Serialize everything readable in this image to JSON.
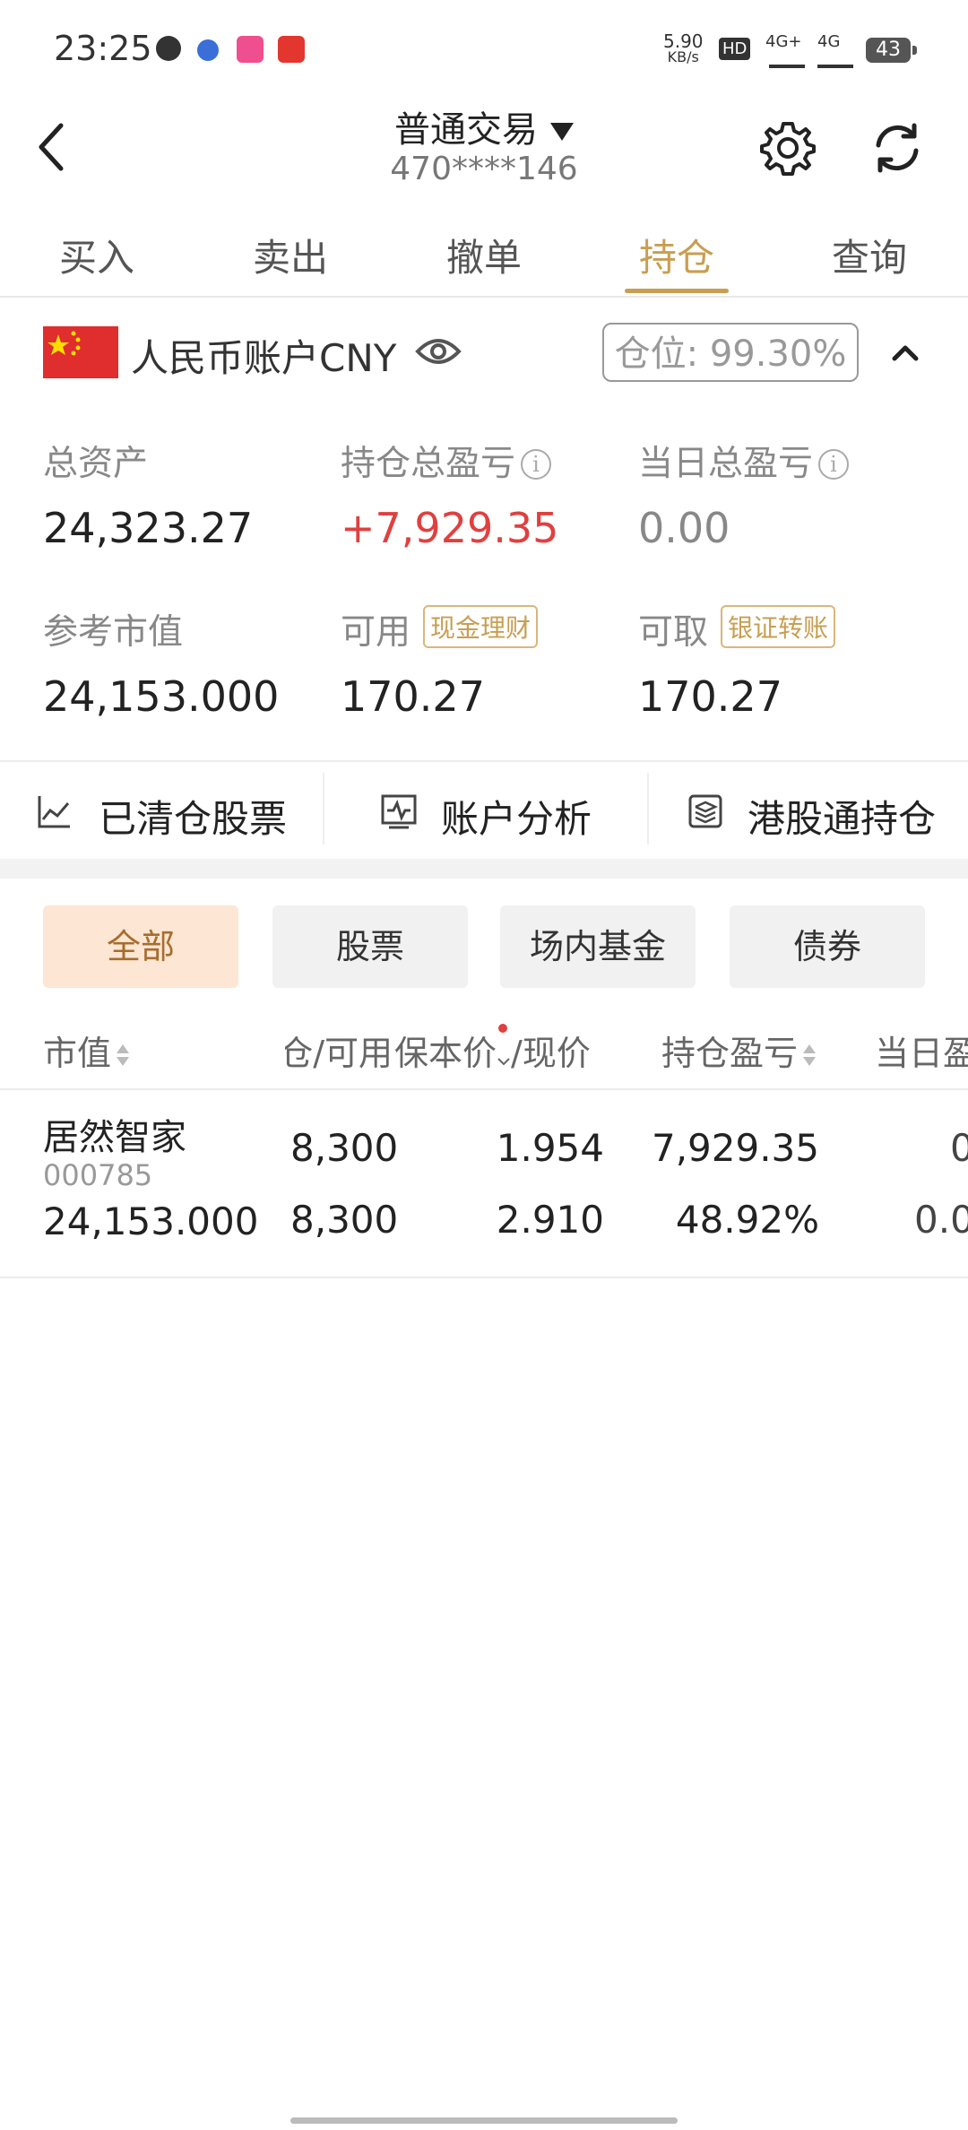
{
  "status_bar": {
    "time": "23:25",
    "net_speed_value": "5.90",
    "net_speed_unit": "KB/s",
    "hd_label": "HD",
    "net1": "4G+",
    "net2": "4G",
    "battery": "43"
  },
  "header": {
    "title": "普通交易",
    "account_masked": "470****146"
  },
  "tabs": [
    "买入",
    "卖出",
    "撤单",
    "持仓",
    "查询"
  ],
  "active_tab": "持仓",
  "account": {
    "currency_label": "人民币账户CNY",
    "position_ratio": "仓位: 99.30%",
    "total_assets_label": "总资产",
    "total_assets": "24,323.27",
    "holding_pnl_label": "持仓总盈亏",
    "holding_pnl": "+7,929.35",
    "daily_pnl_label": "当日总盈亏",
    "daily_pnl": "0.00",
    "market_value_label": "参考市值",
    "market_value": "24,153.000",
    "available_label": "可用",
    "available_tag": "现金理财",
    "available": "170.27",
    "withdrawable_label": "可取",
    "withdrawable_tag": "银证转账",
    "withdrawable": "170.27"
  },
  "quick_actions": [
    "已清仓股票",
    "账户分析",
    "港股通持仓"
  ],
  "filters": [
    "全部",
    "股票",
    "场内基金",
    "债券"
  ],
  "active_filter": "全部",
  "table": {
    "headers": {
      "market_value": "市值",
      "qty": "仓/可用",
      "price": "保本价",
      "price_suffix": "/现价",
      "pnl": "持仓盈亏",
      "daily": "当日盈"
    },
    "rows": [
      {
        "name": "居然智家",
        "code": "000785",
        "market_value": "24,153.000",
        "qty_total": "8,300",
        "qty_available": "8,300",
        "cost_price": "1.954",
        "current_price": "2.910",
        "pnl_amount": "7,929.35",
        "pnl_percent": "48.92%",
        "daily_top": "0",
        "daily_bottom": "0.0"
      }
    ]
  },
  "colors": {
    "accent": "#c89e52",
    "profit": "#e04040",
    "chip_active_bg": "#fde6d3"
  }
}
